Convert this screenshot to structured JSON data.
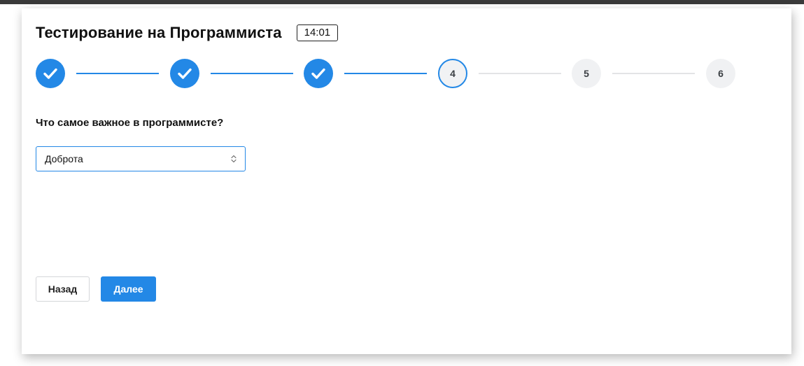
{
  "header": {
    "title": "Тестирование на Программиста",
    "timer": "14:01"
  },
  "stepper": {
    "steps": [
      {
        "label": "",
        "state": "done",
        "icon": "check-icon"
      },
      {
        "label": "",
        "state": "done",
        "icon": "check-icon"
      },
      {
        "label": "",
        "state": "done",
        "icon": "check-icon"
      },
      {
        "label": "4",
        "state": "current"
      },
      {
        "label": "5",
        "state": "pending"
      },
      {
        "label": "6",
        "state": "pending"
      }
    ]
  },
  "question": {
    "text": "Что самое важное в программисте?",
    "answer_select": {
      "selected": "Доброта",
      "icon": "select-arrows-icon"
    }
  },
  "actions": {
    "back_label": "Назад",
    "next_label": "Далее"
  },
  "colors": {
    "accent": "#2388e6",
    "pending_step": "#f0f1f3",
    "pending_line": "#e3e4e6"
  }
}
